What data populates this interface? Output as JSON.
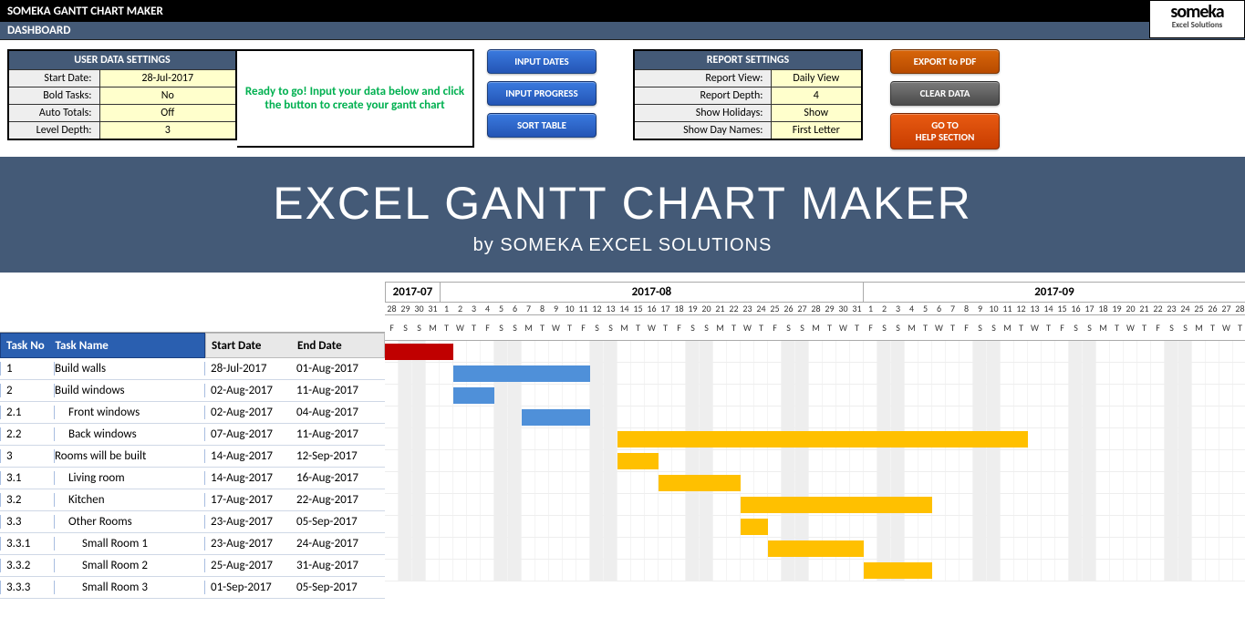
{
  "header": {
    "title": "SOMEKA GANTT CHART MAKER",
    "logo_big": "someka",
    "logo_small": "Excel Solutions",
    "dashboard": "DASHBOARD"
  },
  "user_settings": {
    "title": "USER DATA SETTINGS",
    "rows": [
      {
        "label": "Start Date:",
        "value": "28-Jul-2017"
      },
      {
        "label": "Bold Tasks:",
        "value": "No"
      },
      {
        "label": "Auto Totals:",
        "value": "Off"
      },
      {
        "label": "Level Depth:",
        "value": "3"
      }
    ]
  },
  "message": "Ready to go! Input your data below and click the button to create your gantt chart",
  "buttons_left": [
    "INPUT DATES",
    "INPUT PROGRESS",
    "SORT TABLE"
  ],
  "report_settings": {
    "title": "REPORT SETTINGS",
    "rows": [
      {
        "label": "Report View:",
        "value": "Daily View"
      },
      {
        "label": "Report Depth:",
        "value": "4"
      },
      {
        "label": "Show Holidays:",
        "value": "Show"
      },
      {
        "label": "Show Day Names:",
        "value": "First Letter"
      }
    ]
  },
  "buttons_right": [
    {
      "label": "EXPORT to PDF",
      "cls": "btn-orange"
    },
    {
      "label": "CLEAR DATA",
      "cls": "btn-gray"
    },
    {
      "label": "GO TO HELP SECTION",
      "cls": "btn-red-orange"
    }
  ],
  "banner": {
    "big": "EXCEL GANTT CHART MAKER",
    "sub": "by SOMEKA EXCEL SOLUTIONS"
  },
  "task_headers": {
    "no": "Task No",
    "name": "Task Name",
    "start": "Start Date",
    "end": "End Date"
  },
  "chart_data": {
    "type": "gantt",
    "start_date": "2017-07-28",
    "months": [
      {
        "label": "2017-07",
        "days": 4
      },
      {
        "label": "2017-08",
        "days": 31
      },
      {
        "label": "2017-09",
        "days": 28
      }
    ],
    "day_numbers": [
      28,
      29,
      30,
      31,
      1,
      2,
      3,
      4,
      5,
      6,
      7,
      8,
      9,
      10,
      11,
      12,
      13,
      14,
      15,
      16,
      17,
      18,
      19,
      20,
      21,
      22,
      23,
      24,
      25,
      26,
      27,
      28,
      29,
      30,
      31,
      1,
      2,
      3,
      4,
      5,
      6,
      7,
      8,
      9,
      10,
      11,
      12,
      13,
      14,
      15,
      16,
      17,
      18,
      19,
      20,
      21,
      22,
      23,
      24,
      25,
      26,
      27,
      28
    ],
    "day_letters": [
      "F",
      "S",
      "S",
      "M",
      "T",
      "W",
      "T",
      "F",
      "S",
      "S",
      "M",
      "T",
      "W",
      "T",
      "F",
      "S",
      "S",
      "M",
      "T",
      "W",
      "T",
      "F",
      "S",
      "S",
      "M",
      "T",
      "W",
      "T",
      "F",
      "S",
      "S",
      "M",
      "T",
      "W",
      "T",
      "F",
      "S",
      "S",
      "M",
      "T",
      "W",
      "T",
      "F",
      "S",
      "S",
      "M",
      "T",
      "W",
      "T",
      "F",
      "S",
      "S",
      "M",
      "T",
      "W",
      "T",
      "F",
      "S",
      "S",
      "M",
      "T",
      "W",
      "T"
    ],
    "weekend_idx": [
      1,
      2,
      8,
      9,
      15,
      16,
      22,
      23,
      29,
      30,
      36,
      37,
      43,
      44,
      50,
      51,
      57,
      58
    ],
    "tasks": [
      {
        "no": "1",
        "name": "Build walls",
        "indent": 0,
        "start": "28-Jul-2017",
        "end": "01-Aug-2017",
        "bar_start": 0,
        "bar_len": 5,
        "color": "red"
      },
      {
        "no": "2",
        "name": "Build windows",
        "indent": 0,
        "start": "02-Aug-2017",
        "end": "11-Aug-2017",
        "bar_start": 5,
        "bar_len": 10,
        "color": "blue"
      },
      {
        "no": "2.1",
        "name": "Front windows",
        "indent": 1,
        "start": "02-Aug-2017",
        "end": "04-Aug-2017",
        "bar_start": 5,
        "bar_len": 3,
        "color": "blue"
      },
      {
        "no": "2.2",
        "name": "Back windows",
        "indent": 1,
        "start": "07-Aug-2017",
        "end": "11-Aug-2017",
        "bar_start": 10,
        "bar_len": 5,
        "color": "blue"
      },
      {
        "no": "3",
        "name": "Rooms will be built",
        "indent": 0,
        "start": "14-Aug-2017",
        "end": "12-Sep-2017",
        "bar_start": 17,
        "bar_len": 30,
        "color": "orange"
      },
      {
        "no": "3.1",
        "name": "Living room",
        "indent": 1,
        "start": "14-Aug-2017",
        "end": "16-Aug-2017",
        "bar_start": 17,
        "bar_len": 3,
        "color": "orange"
      },
      {
        "no": "3.2",
        "name": "Kitchen",
        "indent": 1,
        "start": "17-Aug-2017",
        "end": "22-Aug-2017",
        "bar_start": 20,
        "bar_len": 6,
        "color": "orange"
      },
      {
        "no": "3.3",
        "name": "Other Rooms",
        "indent": 1,
        "start": "23-Aug-2017",
        "end": "05-Sep-2017",
        "bar_start": 26,
        "bar_len": 14,
        "color": "orange"
      },
      {
        "no": "3.3.1",
        "name": "Small Room 1",
        "indent": 2,
        "start": "23-Aug-2017",
        "end": "24-Aug-2017",
        "bar_start": 26,
        "bar_len": 2,
        "color": "orange"
      },
      {
        "no": "3.3.2",
        "name": "Small Room 2",
        "indent": 2,
        "start": "25-Aug-2017",
        "end": "31-Aug-2017",
        "bar_start": 28,
        "bar_len": 7,
        "color": "orange"
      },
      {
        "no": "3.3.3",
        "name": "Small Room 3",
        "indent": 2,
        "start": "01-Sep-2017",
        "end": "05-Sep-2017",
        "bar_start": 35,
        "bar_len": 5,
        "color": "orange"
      }
    ]
  }
}
